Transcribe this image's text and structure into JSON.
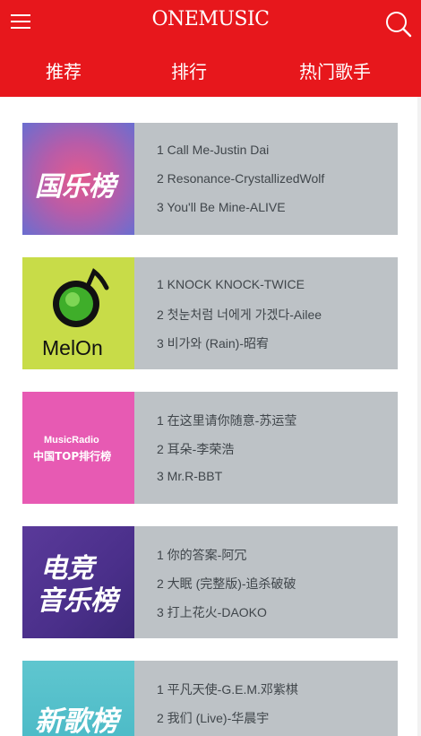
{
  "app": {
    "title": "ONEMUSIC"
  },
  "nav": {
    "tabs": [
      "推荐",
      "排行",
      "热门歌手"
    ]
  },
  "charts": [
    {
      "cover_label": "国乐榜",
      "tracks": [
        "1 Call Me-Justin Dai",
        "2 Resonance-CrystallizedWolf",
        "3 You'll Be Mine-ALIVE"
      ]
    },
    {
      "cover_label": "MelOn",
      "tracks": [
        "1 KNOCK KNOCK-TWICE",
        "2 첫눈처럼 너에게 가겠다-Ailee",
        "3 비가와 (Rain)-昭宥"
      ]
    },
    {
      "cover_label_line1": "MusicRadio",
      "cover_label_line2": "中国TOP排行榜",
      "tracks": [
        "1 在这里请你随意-苏运莹",
        "2 耳朵-李荣浩",
        "3 Mr.R-BBT"
      ]
    },
    {
      "cover_label_line1": "电竞",
      "cover_label_line2": "音乐榜",
      "tracks": [
        "1 你的答案-阿冗",
        "2 大眠 (完整版)-追杀破破",
        "3 打上花火-DAOKO"
      ]
    },
    {
      "cover_label": "新歌榜",
      "tracks": [
        "1 平凡天使-G.E.M.邓紫棋",
        "2 我们 (Live)-华晨宇"
      ]
    }
  ],
  "colors": {
    "brand_red": "#e7171c",
    "card_bg": "#bdc2c6",
    "track_text": "#40464b"
  },
  "icons": {
    "menu": "hamburger-menu-icon",
    "search": "search-icon"
  }
}
